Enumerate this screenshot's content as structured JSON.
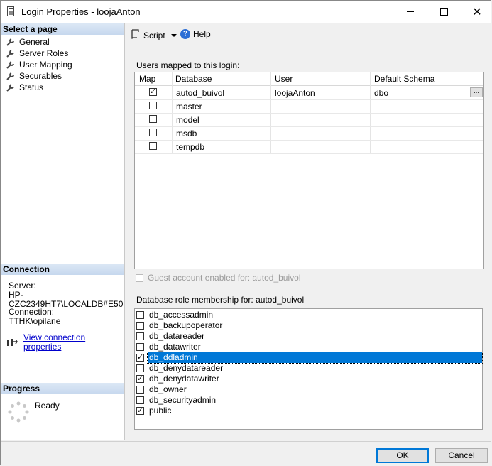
{
  "window": {
    "title": "Login Properties - loojaAnton"
  },
  "left": {
    "select_header": "Select a page",
    "pages": [
      "General",
      "Server Roles",
      "User Mapping",
      "Securables",
      "Status"
    ],
    "connection_header": "Connection",
    "server_label": "Server:",
    "server_value": "HP-CZC2349HT7\\LOCALDB#E50",
    "connection_label": "Connection:",
    "connection_value": "TTHK\\opilane",
    "view_link": "View connection properties",
    "progress_header": "Progress",
    "progress_status": "Ready"
  },
  "toolbar": {
    "script_label": "Script",
    "help_label": "Help"
  },
  "users_mapped": {
    "label": "Users mapped to this login:",
    "columns": [
      "Map",
      "Database",
      "User",
      "Default Schema"
    ],
    "rows": [
      {
        "map": true,
        "database": "autod_buivol",
        "user": "loojaAnton",
        "schema": "dbo"
      },
      {
        "map": false,
        "database": "master",
        "user": "",
        "schema": ""
      },
      {
        "map": false,
        "database": "model",
        "user": "",
        "schema": ""
      },
      {
        "map": false,
        "database": "msdb",
        "user": "",
        "schema": ""
      },
      {
        "map": false,
        "database": "tempdb",
        "user": "",
        "schema": ""
      }
    ],
    "ellipsis": "..."
  },
  "guest": {
    "label": "Guest account enabled for: autod_buivol",
    "checked": false
  },
  "roles": {
    "label": "Database role membership for: autod_buivol",
    "items": [
      {
        "name": "db_accessadmin",
        "checked": false
      },
      {
        "name": "db_backupoperator",
        "checked": false
      },
      {
        "name": "db_datareader",
        "checked": false
      },
      {
        "name": "db_datawriter",
        "checked": false
      },
      {
        "name": "db_ddladmin",
        "checked": true,
        "selected": true
      },
      {
        "name": "db_denydatareader",
        "checked": false
      },
      {
        "name": "db_denydatawriter",
        "checked": true
      },
      {
        "name": "db_owner",
        "checked": false
      },
      {
        "name": "db_securityadmin",
        "checked": false
      },
      {
        "name": "public",
        "checked": true
      }
    ]
  },
  "buttons": {
    "ok": "OK",
    "cancel": "Cancel"
  },
  "colors": {
    "selection": "#0078d7",
    "link": "#0000cc",
    "header_gradient_top": "#dce8f5"
  }
}
